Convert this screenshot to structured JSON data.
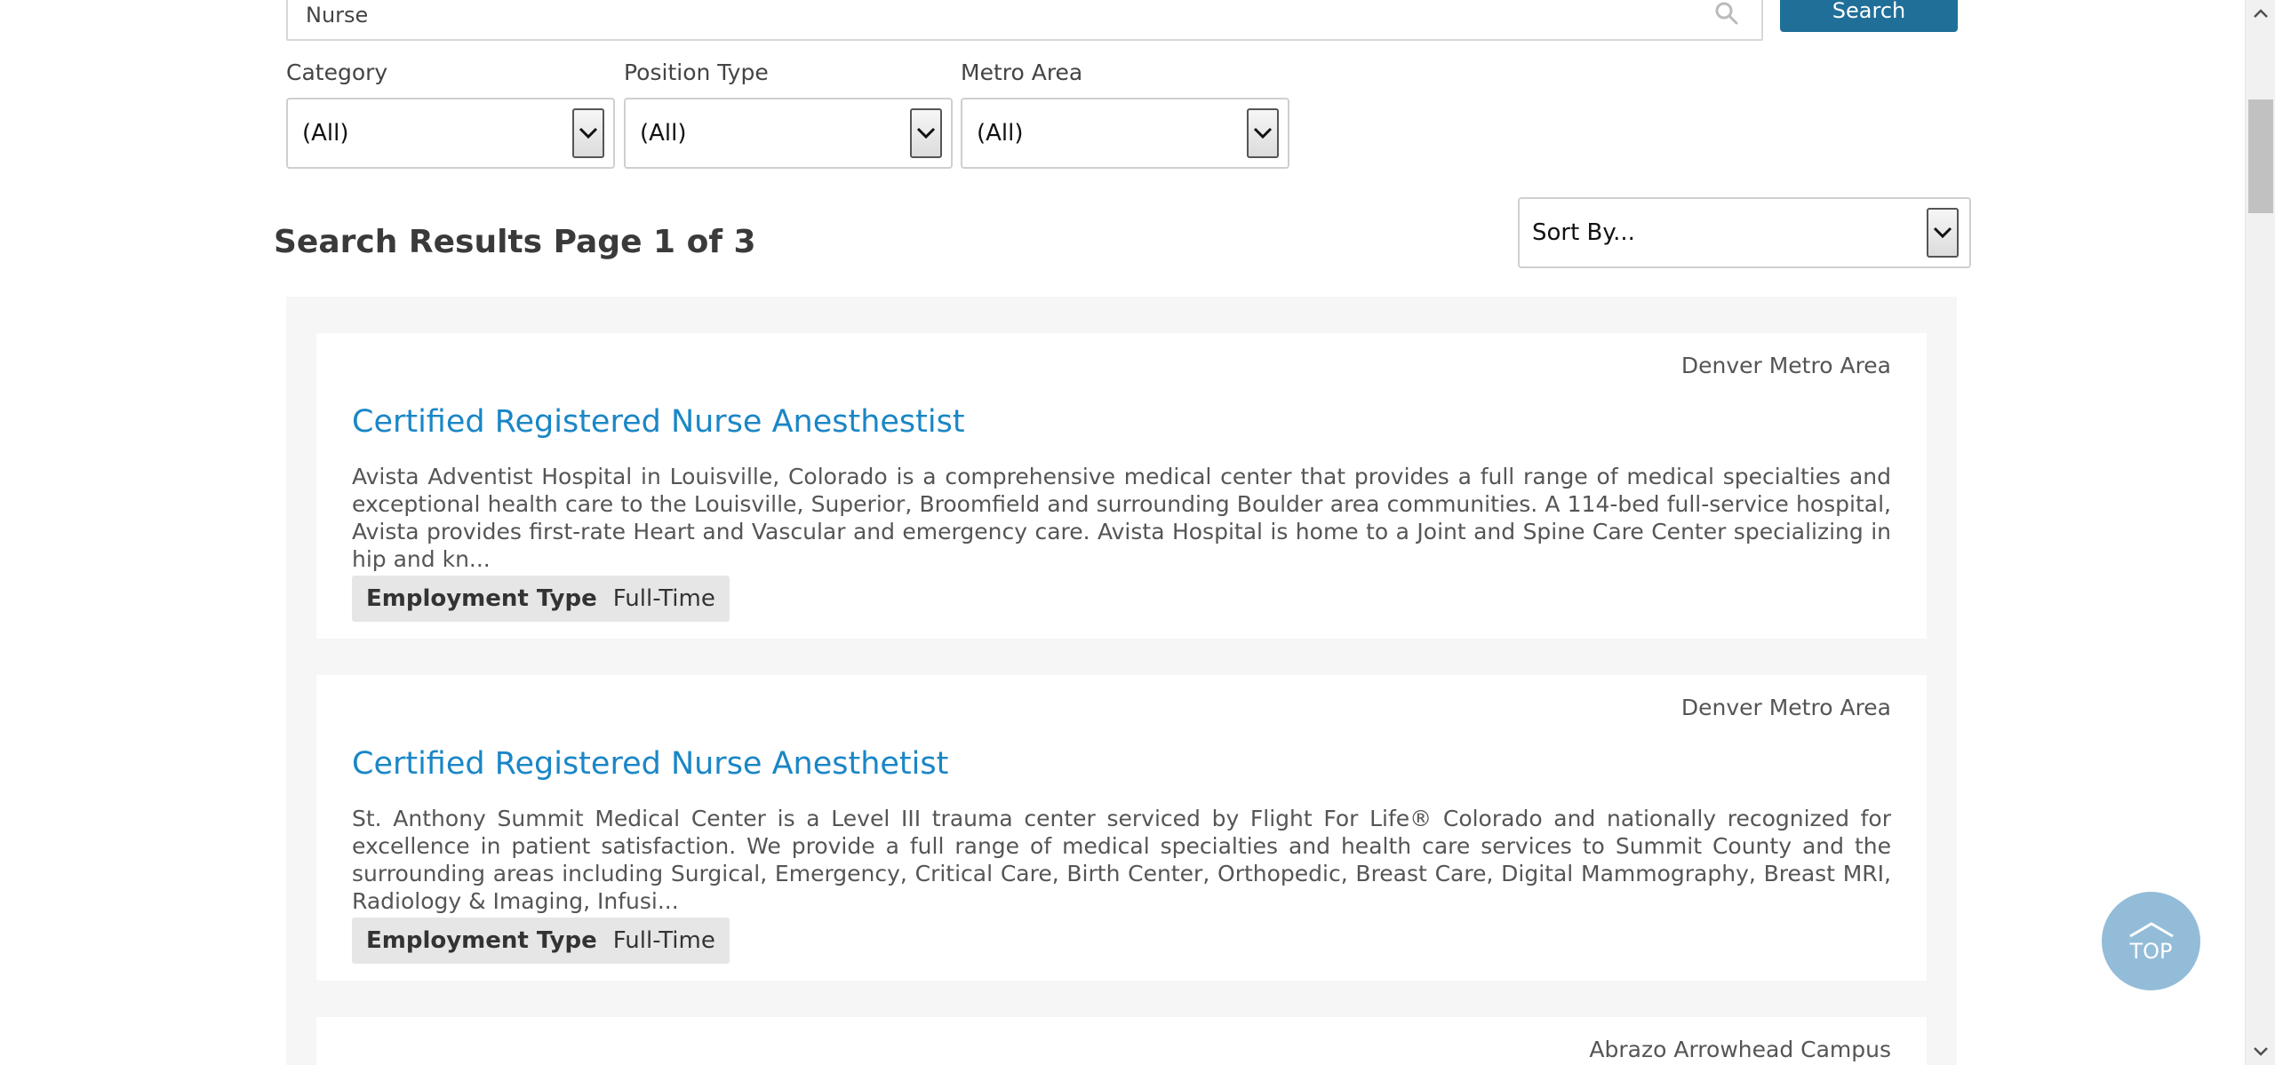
{
  "search": {
    "value": "Nurse",
    "button_label": "Search"
  },
  "filters": [
    {
      "label": "Category",
      "selected": "(All)"
    },
    {
      "label": "Position Type",
      "selected": "(All)"
    },
    {
      "label": "Metro Area",
      "selected": "(All)"
    }
  ],
  "results": {
    "title": "Search Results Page 1 of 3",
    "sort_label": "Sort By...",
    "items": [
      {
        "location": "Denver Metro Area",
        "title": "Certified Registered Nurse Anesthestist",
        "description": "Avista Adventist Hospital in Louisville, Colorado is a comprehensive medical center that provides a full range of medical specialties and exceptional health care to the Louisville, Superior, Broomfield and surrounding Boulder area communities. A 114-bed full-service hospital, Avista provides first-rate Heart and Vascular and emergency care. Avista Hospital is home to a Joint and Spine Care Center specializing in hip and kn...",
        "employment_label": "Employment Type",
        "employment_value": "Full-Time"
      },
      {
        "location": "Denver Metro Area",
        "title": "Certified Registered Nurse Anesthetist",
        "description": "St. Anthony Summit Medical Center is a Level III trauma center serviced by Flight For Life® Colorado and nationally recognized for excellence in patient satisfaction. We provide a full range of medical specialties and health care services to Summit County and the surrounding areas including Surgical, Emergency, Critical Care, Birth Center, Orthopedic, Breast Care, Digital Mammography, Breast MRI, Radiology & Imaging, Infusi...",
        "employment_label": "Employment Type",
        "employment_value": "Full-Time"
      },
      {
        "location": "Abrazo Arrowhead Campus"
      }
    ]
  },
  "top_button": {
    "label": "TOP"
  },
  "colors": {
    "accent": "#1f6f98",
    "link": "#1a86c6",
    "top_button": "#93bcd8"
  }
}
